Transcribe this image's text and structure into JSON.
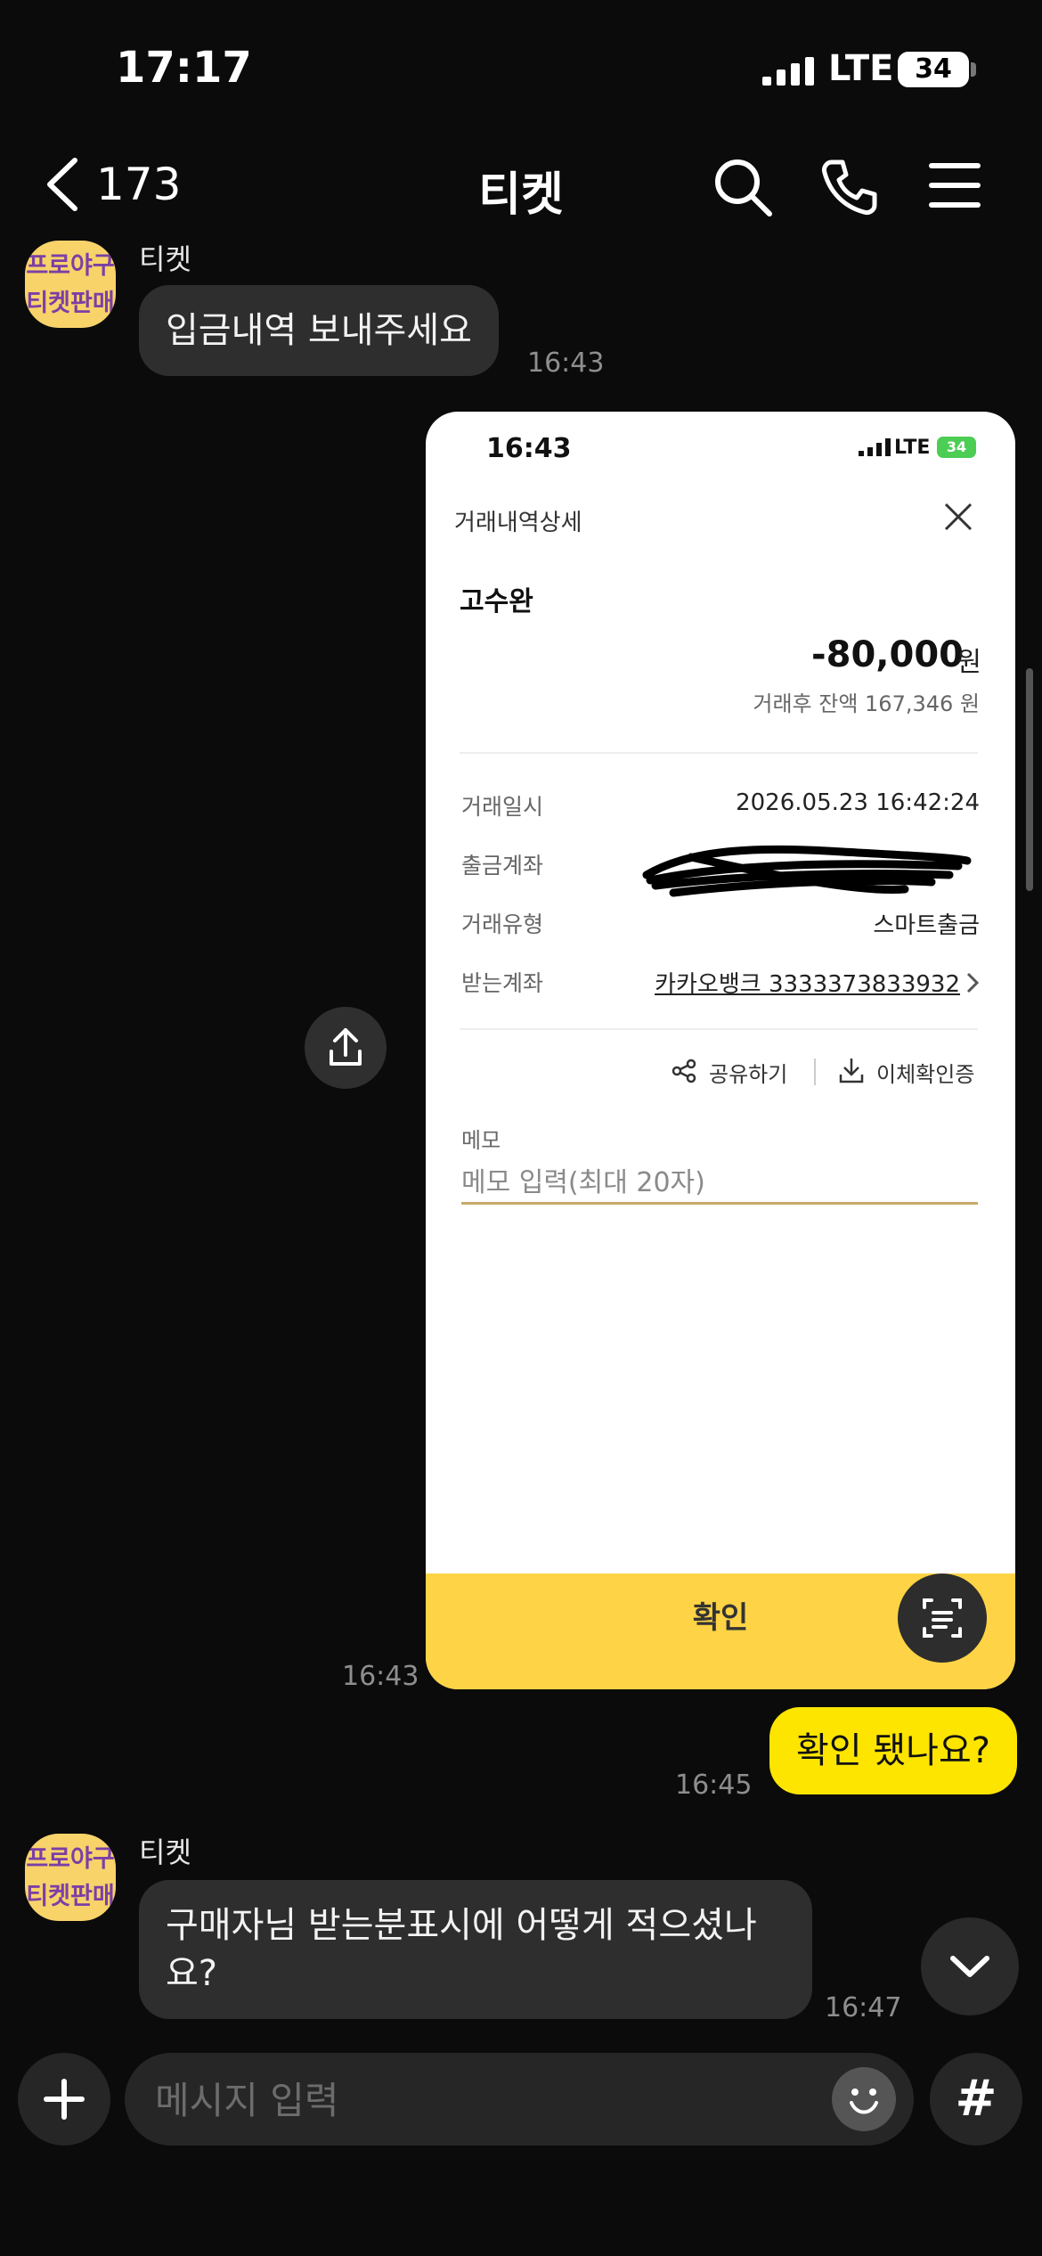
{
  "status_bar": {
    "time": "17:17",
    "network": "LTE",
    "battery": "34"
  },
  "top_bar": {
    "back_count": "173",
    "title": "티켓"
  },
  "messages": [
    {
      "sender": "티켓",
      "avatar_text": [
        "프로야구",
        "티켓판매"
      ],
      "text": "입금내역 보내주세요",
      "time": "16:43"
    },
    {
      "type": "image",
      "time": "16:43"
    },
    {
      "type": "out",
      "text": "확인 됐나요?",
      "time": "16:45"
    },
    {
      "sender": "티켓",
      "avatar_text": [
        "프로야구",
        "티켓판매"
      ],
      "text": "구매자님 받는분표시에 어떻게 적으셨나요?",
      "time": "16:47"
    }
  ],
  "screenshot": {
    "status_time": "16:43",
    "network": "LTE",
    "battery": "34",
    "header": "거래내역상세",
    "name": "고수완",
    "amount": "-80,000",
    "amount_unit": "원",
    "balance": "거래후 잔액 167,346 원",
    "rows": [
      {
        "label": "거래일시",
        "value": "2026.05.23 16:42:24"
      },
      {
        "label": "출금계좌",
        "value": ""
      },
      {
        "label": "거래유형",
        "value": "스마트출금"
      },
      {
        "label": "받는계좌",
        "value": "카카오뱅크 3333373833932"
      }
    ],
    "share": "공유하기",
    "certificate": "이체확인증",
    "memo_label": "메모",
    "memo_placeholder": "메모 입력(최대 20자)",
    "confirm": "확인"
  },
  "input": {
    "placeholder": "메시지 입력",
    "hash": "#"
  }
}
